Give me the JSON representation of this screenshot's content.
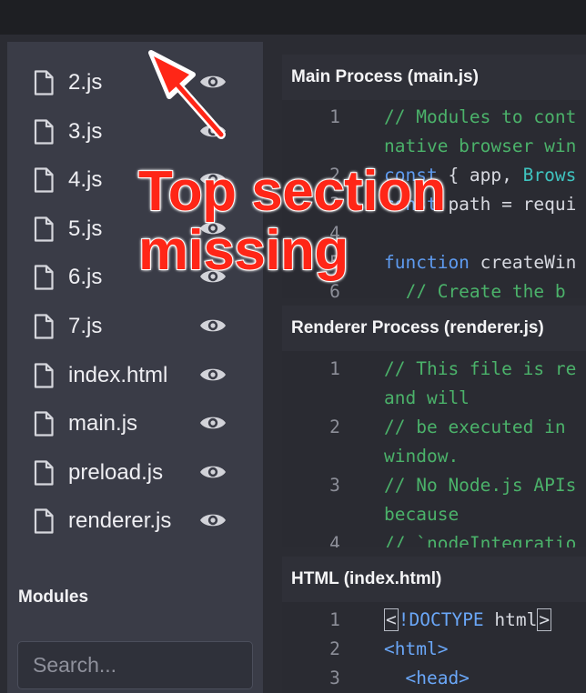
{
  "sidebar": {
    "files": [
      {
        "label": "2.js"
      },
      {
        "label": "3.js"
      },
      {
        "label": "4.js"
      },
      {
        "label": "5.js"
      },
      {
        "label": "6.js"
      },
      {
        "label": "7.js"
      },
      {
        "label": "index.html"
      },
      {
        "label": "main.js"
      },
      {
        "label": "preload.js"
      },
      {
        "label": "renderer.js"
      }
    ],
    "modules_heading": "Modules",
    "search_placeholder": "Search..."
  },
  "panels": {
    "main": {
      "title": "Main Process (main.js)",
      "lines": [
        {
          "no": "1",
          "parts": [
            {
              "t": "// Modules to cont",
              "c": "comment"
            }
          ]
        },
        {
          "no": "",
          "parts": [
            {
              "t": "native browser win",
              "c": "comment"
            }
          ]
        },
        {
          "no": "2",
          "parts": [
            {
              "t": "const",
              "c": "keyword"
            },
            {
              "t": " { app, ",
              "c": "plain"
            },
            {
              "t": "Brows",
              "c": "type"
            }
          ]
        },
        {
          "no": "3",
          "parts": [
            {
              "t": "const",
              "c": "keyword"
            },
            {
              "t": " path = requi",
              "c": "plain"
            }
          ]
        },
        {
          "no": "4",
          "parts": []
        },
        {
          "no": "5",
          "parts": [
            {
              "t": "function",
              "c": "keyword"
            },
            {
              "t": " createWin",
              "c": "plain"
            }
          ]
        },
        {
          "no": "6",
          "parts": [
            {
              "t": "  // Create the b",
              "c": "comment"
            }
          ]
        }
      ]
    },
    "renderer": {
      "title": "Renderer Process (renderer.js)",
      "lines": [
        {
          "no": "1",
          "parts": [
            {
              "t": "// This file is re",
              "c": "comment"
            }
          ]
        },
        {
          "no": "",
          "parts": [
            {
              "t": "and will",
              "c": "comment"
            }
          ]
        },
        {
          "no": "2",
          "parts": [
            {
              "t": "// be executed in",
              "c": "comment"
            }
          ]
        },
        {
          "no": "",
          "parts": [
            {
              "t": "window.",
              "c": "comment"
            }
          ]
        },
        {
          "no": "3",
          "parts": [
            {
              "t": "// No Node.js APIs",
              "c": "comment"
            }
          ]
        },
        {
          "no": "",
          "parts": [
            {
              "t": "because",
              "c": "comment"
            }
          ]
        },
        {
          "no": "4",
          "parts": [
            {
              "t": "// `nodeIntegratio",
              "c": "comment"
            }
          ]
        }
      ]
    },
    "html": {
      "title": "HTML (index.html)",
      "lines": [
        {
          "no": "1",
          "parts": [
            {
              "t": "<",
              "c": "bracket"
            },
            {
              "t": "!DOCTYPE ",
              "c": "tag"
            },
            {
              "t": "html",
              "c": "plain"
            },
            {
              "t": ">",
              "c": "bracket"
            }
          ]
        },
        {
          "no": "2",
          "parts": [
            {
              "t": "<html>",
              "c": "tag"
            }
          ]
        },
        {
          "no": "3",
          "parts": [
            {
              "t": "  <head>",
              "c": "tag"
            }
          ]
        }
      ]
    }
  },
  "annotation": {
    "line1": "Top section",
    "line2": "missing"
  },
  "colors": {
    "accent_annotation": "#ff2617",
    "comment": "#4bb26a",
    "keyword": "#5e9bf0"
  }
}
